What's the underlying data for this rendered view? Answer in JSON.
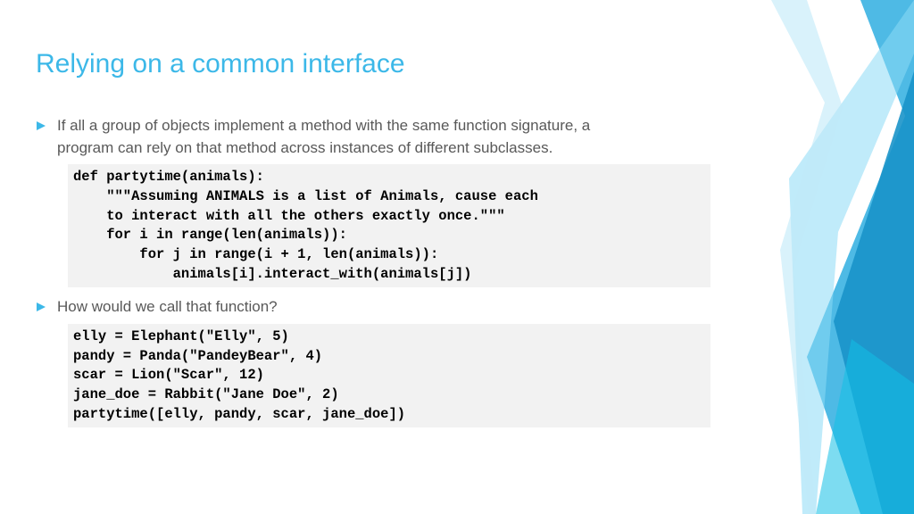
{
  "title": "Relying on a common interface",
  "bullet1": "If all a group of objects implement a method with the same function signature, a program can rely on that method across instances of different subclasses.",
  "code1": "def partytime(animals):\n    \"\"\"Assuming ANIMALS is a list of Animals, cause each\n    to interact with all the others exactly once.\"\"\"\n    for i in range(len(animals)):\n        for j in range(i + 1, len(animals)):\n            animals[i].interact_with(animals[j])",
  "bullet2": "How would we call that function?",
  "code2": "elly = Elephant(\"Elly\", 5)\npandy = Panda(\"PandeyBear\", 4)\nscar = Lion(\"Scar\", 12)\njane_doe = Rabbit(\"Jane Doe\", 2)\npartytime([elly, pandy, scar, jane_doe])",
  "colors": {
    "accent": "#3cb8e8",
    "text": "#595959",
    "codebg": "#f2f2f2"
  }
}
